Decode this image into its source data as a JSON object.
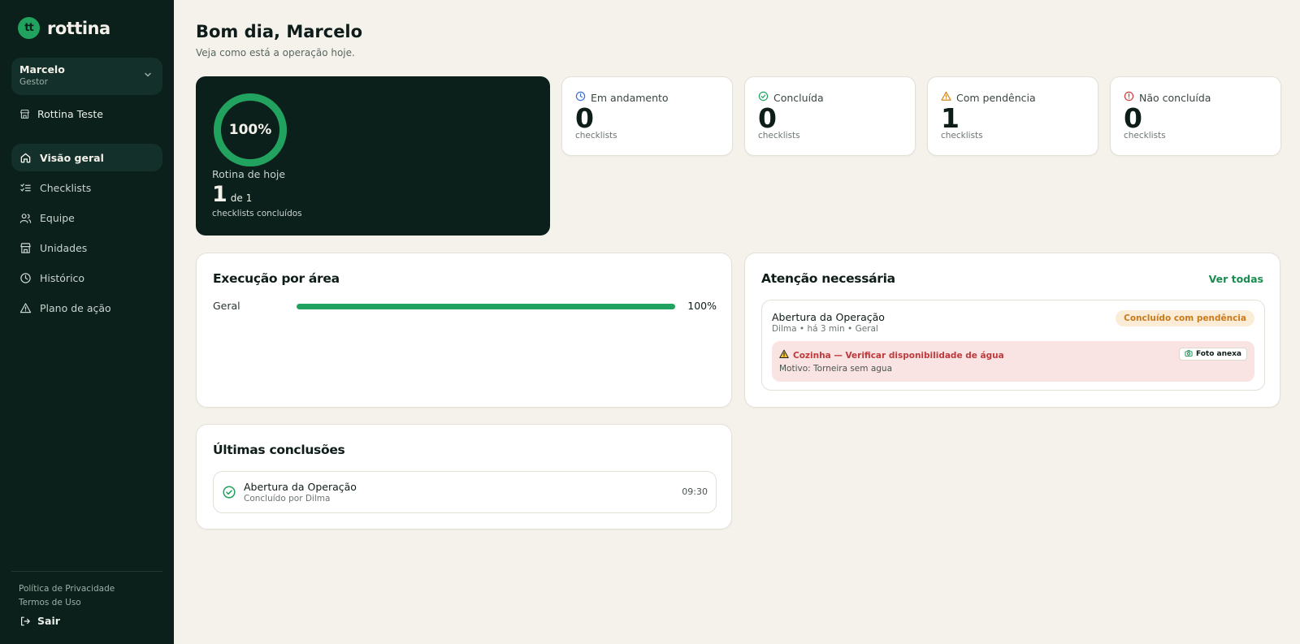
{
  "brand": {
    "logo_text": "tt",
    "name": "rottina"
  },
  "user": {
    "name": "Marcelo",
    "role": "Gestor"
  },
  "unit": {
    "name": "Rottina Teste"
  },
  "nav": [
    {
      "label": "Visão geral",
      "icon": "home-icon",
      "active": true
    },
    {
      "label": "Checklists",
      "icon": "checklist-icon"
    },
    {
      "label": "Equipe",
      "icon": "users-icon"
    },
    {
      "label": "Unidades",
      "icon": "store-icon"
    },
    {
      "label": "Histórico",
      "icon": "clock-icon"
    },
    {
      "label": "Plano de ação",
      "icon": "warning-icon"
    }
  ],
  "footer": {
    "privacy": "Política de Privacidade",
    "terms": "Termos de Uso",
    "logout": "Sair"
  },
  "header": {
    "greeting": "Bom dia, Marcelo",
    "subtitle": "Veja como está a operação hoje."
  },
  "routine": {
    "percent_label": "100%",
    "percent": 100,
    "title": "Rotina de hoje",
    "done": "1",
    "of_total": "de 1",
    "subtitle": "checklists concluídos"
  },
  "stats": [
    {
      "label": "Em andamento",
      "value": "0",
      "unit": "checklists",
      "icon": "clock-icon",
      "color": "#3b6fd4"
    },
    {
      "label": "Concluída",
      "value": "0",
      "unit": "checklists",
      "icon": "check-circle-icon",
      "color": "#21a35f"
    },
    {
      "label": "Com pendência",
      "value": "1",
      "unit": "checklists",
      "icon": "warning-icon",
      "color": "#d48a1f"
    },
    {
      "label": "Não concluída",
      "value": "0",
      "unit": "checklists",
      "icon": "alert-circle-icon",
      "color": "#d23c3c"
    }
  ],
  "execution": {
    "title": "Execução por área",
    "areas": [
      {
        "name": "Geral",
        "percent": 100,
        "percent_label": "100%"
      }
    ]
  },
  "attention": {
    "title": "Atenção necessária",
    "see_all": "Ver todas",
    "items": [
      {
        "title": "Abertura da Operação",
        "meta": "Dilma • há 3 min • Geral",
        "badge": "Concluído com pendência",
        "issue": "Cozinha — Verificar disponibilidade de água",
        "reason": "Motivo: Torneira sem agua",
        "photo": "Foto anexa"
      }
    ]
  },
  "recent": {
    "title": "Últimas conclusões",
    "items": [
      {
        "title": "Abertura da Operação",
        "subtitle": "Concluído por Dilma",
        "time": "09:30"
      }
    ]
  },
  "colors": {
    "sidebar": "#0b1f1b",
    "accent": "#21a35f",
    "background": "#f5f2ec"
  }
}
